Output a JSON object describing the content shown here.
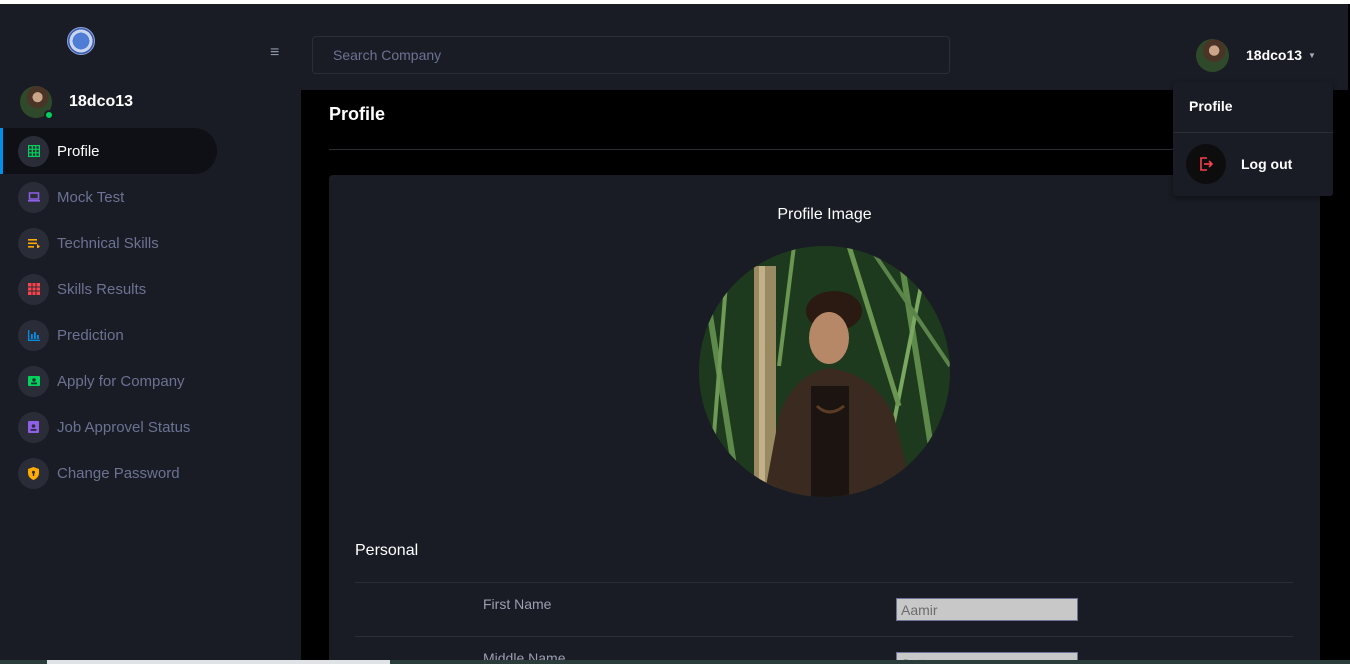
{
  "sidebar": {
    "username": "18dco13",
    "items": [
      {
        "label": "Profile",
        "icon": "grid-icon",
        "color": "#00d25b",
        "active": true
      },
      {
        "label": "Mock Test",
        "icon": "laptop-icon",
        "color": "#8f5fe8",
        "active": false
      },
      {
        "label": "Technical Skills",
        "icon": "list-icon",
        "color": "#ffab00",
        "active": false
      },
      {
        "label": "Skills Results",
        "icon": "table-icon",
        "color": "#fc424a",
        "active": false
      },
      {
        "label": "Prediction",
        "icon": "bar-chart-icon",
        "color": "#0090e7",
        "active": false
      },
      {
        "label": "Apply for Company",
        "icon": "contacts-icon",
        "color": "#00d25b",
        "active": false
      },
      {
        "label": "Job Approvel Status",
        "icon": "badge-icon",
        "color": "#8f5fe8",
        "active": false
      },
      {
        "label": "Change Password",
        "icon": "shield-icon",
        "color": "#ffab00",
        "active": false
      }
    ]
  },
  "navbar": {
    "search_placeholder": "Search Company",
    "username": "18dco13"
  },
  "dropdown": {
    "header": "Profile",
    "logout_label": "Log out",
    "logout_color": "#fc424a"
  },
  "main": {
    "title": "Profile",
    "image_heading": "Profile Image",
    "section_personal": "Personal",
    "fields": [
      {
        "label": "First Name",
        "value": "Aamir"
      },
      {
        "label": "Middle Name",
        "value": "Sattar"
      }
    ]
  },
  "colors": {
    "accent": "#0090e7",
    "background": "#191c24",
    "content_bg": "#000000"
  }
}
